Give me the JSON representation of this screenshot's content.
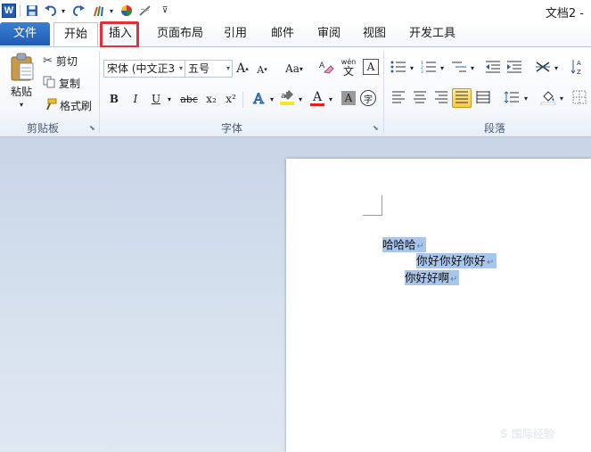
{
  "window": {
    "title": "文档2 - "
  },
  "tabs": [
    {
      "key": "file",
      "label": "文件"
    },
    {
      "key": "home",
      "label": "开始"
    },
    {
      "key": "insert",
      "label": "插入"
    },
    {
      "key": "layout",
      "label": "页面布局"
    },
    {
      "key": "references",
      "label": "引用"
    },
    {
      "key": "mailings",
      "label": "邮件"
    },
    {
      "key": "review",
      "label": "审阅"
    },
    {
      "key": "view",
      "label": "视图"
    },
    {
      "key": "developer",
      "label": "开发工具"
    }
  ],
  "highlight": {
    "tab": "insert",
    "color": "#e0313b"
  },
  "clipboard": {
    "paste_label": "粘贴",
    "cut_label": "剪切",
    "copy_label": "复制",
    "format_painter_label": "格式刷",
    "group_label": "剪贴板"
  },
  "font": {
    "font_name": "宋体 (中文正3",
    "font_size": "五号",
    "group_label": "字体",
    "change_case_label": "Aa",
    "bold": "B",
    "italic": "I",
    "underline": "U",
    "strike": "abc",
    "subscript": "x₂",
    "superscript": "x²",
    "text_effect": "A",
    "font_color": "A",
    "char_shading": "A",
    "enclose": "字",
    "grow": "A",
    "shrink": "A",
    "wen_label": "wén",
    "wen_char": "文",
    "border_char": "A"
  },
  "paragraph": {
    "group_label": "段落"
  },
  "document": {
    "lines": [
      "哈哈哈",
      "你好你好你好",
      "你好好啊"
    ],
    "paragraph_mark": "↵"
  },
  "watermark": "S 国际经验",
  "colors": {
    "accent": "#1e5cb2",
    "selection": "#a9c6ea",
    "font_color_bar": "#e02020",
    "highlight_bar": "#f5e82a"
  }
}
